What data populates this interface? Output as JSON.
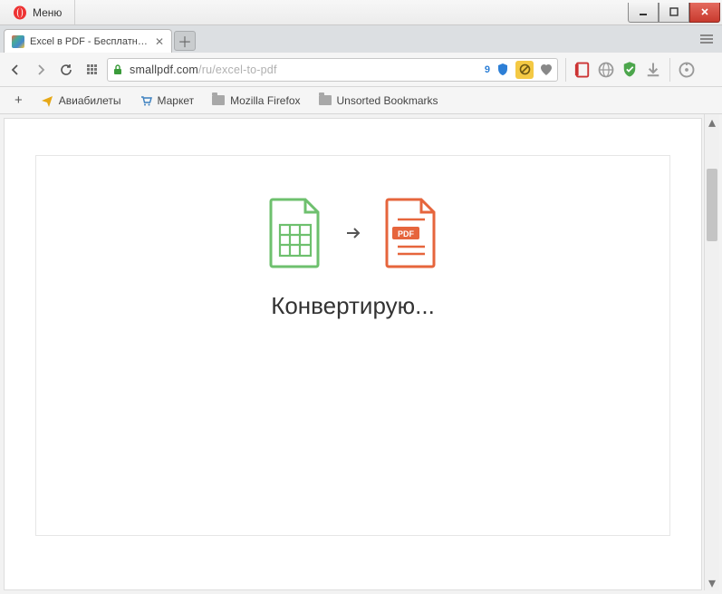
{
  "window": {
    "menu_label": "Меню"
  },
  "tab": {
    "title": "Excel в PDF - Бесплатная к"
  },
  "url": {
    "host": "smallpdf.com",
    "path": "/ru/excel-to-pdf",
    "badge_count": "9"
  },
  "bookmarks": {
    "items": [
      {
        "label": "Авиабилеты",
        "icon": "plane"
      },
      {
        "label": "Маркет",
        "icon": "cart"
      },
      {
        "label": "Mozilla Firefox",
        "icon": "folder"
      },
      {
        "label": "Unsorted Bookmarks",
        "icon": "folder"
      }
    ]
  },
  "page": {
    "status_text": "Конвертирую...",
    "pdf_badge": "PDF"
  }
}
